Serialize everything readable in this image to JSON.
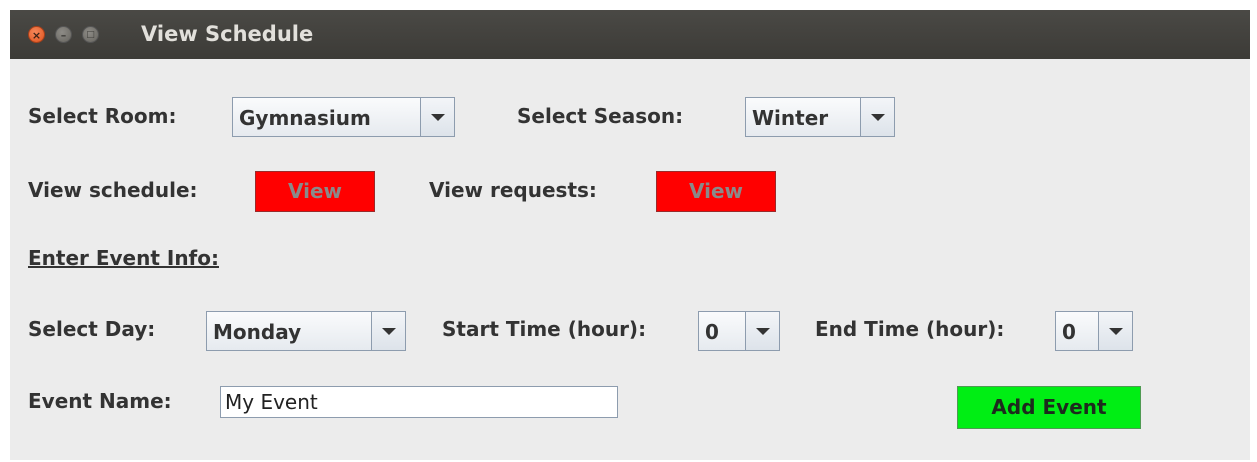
{
  "window": {
    "title": "View Schedule",
    "controls": {
      "close_glyph": "×",
      "minimize_glyph": "–",
      "maximize_glyph": "□"
    }
  },
  "room": {
    "label": "Select Room:",
    "selected": "Gymnasium"
  },
  "season": {
    "label": "Select Season:",
    "selected": "Winter"
  },
  "schedule": {
    "label": "View schedule:",
    "button_label": "View"
  },
  "requests": {
    "label": "View requests:",
    "button_label": "View"
  },
  "event_info": {
    "heading": "Enter Event Info:"
  },
  "day": {
    "label": "Select Day:",
    "selected": "Monday"
  },
  "start_time": {
    "label": "Start Time (hour):",
    "selected": "0"
  },
  "end_time": {
    "label": "End Time (hour):",
    "selected": "0"
  },
  "event_name": {
    "label": "Event Name:",
    "value": "My Event"
  },
  "add_event": {
    "button_label": "Add Event"
  },
  "colors": {
    "view_button_bg": "#ff0000",
    "add_event_bg": "#00ee14",
    "window_bg": "#ececec",
    "titlebar_bg": "#3c3b37"
  }
}
